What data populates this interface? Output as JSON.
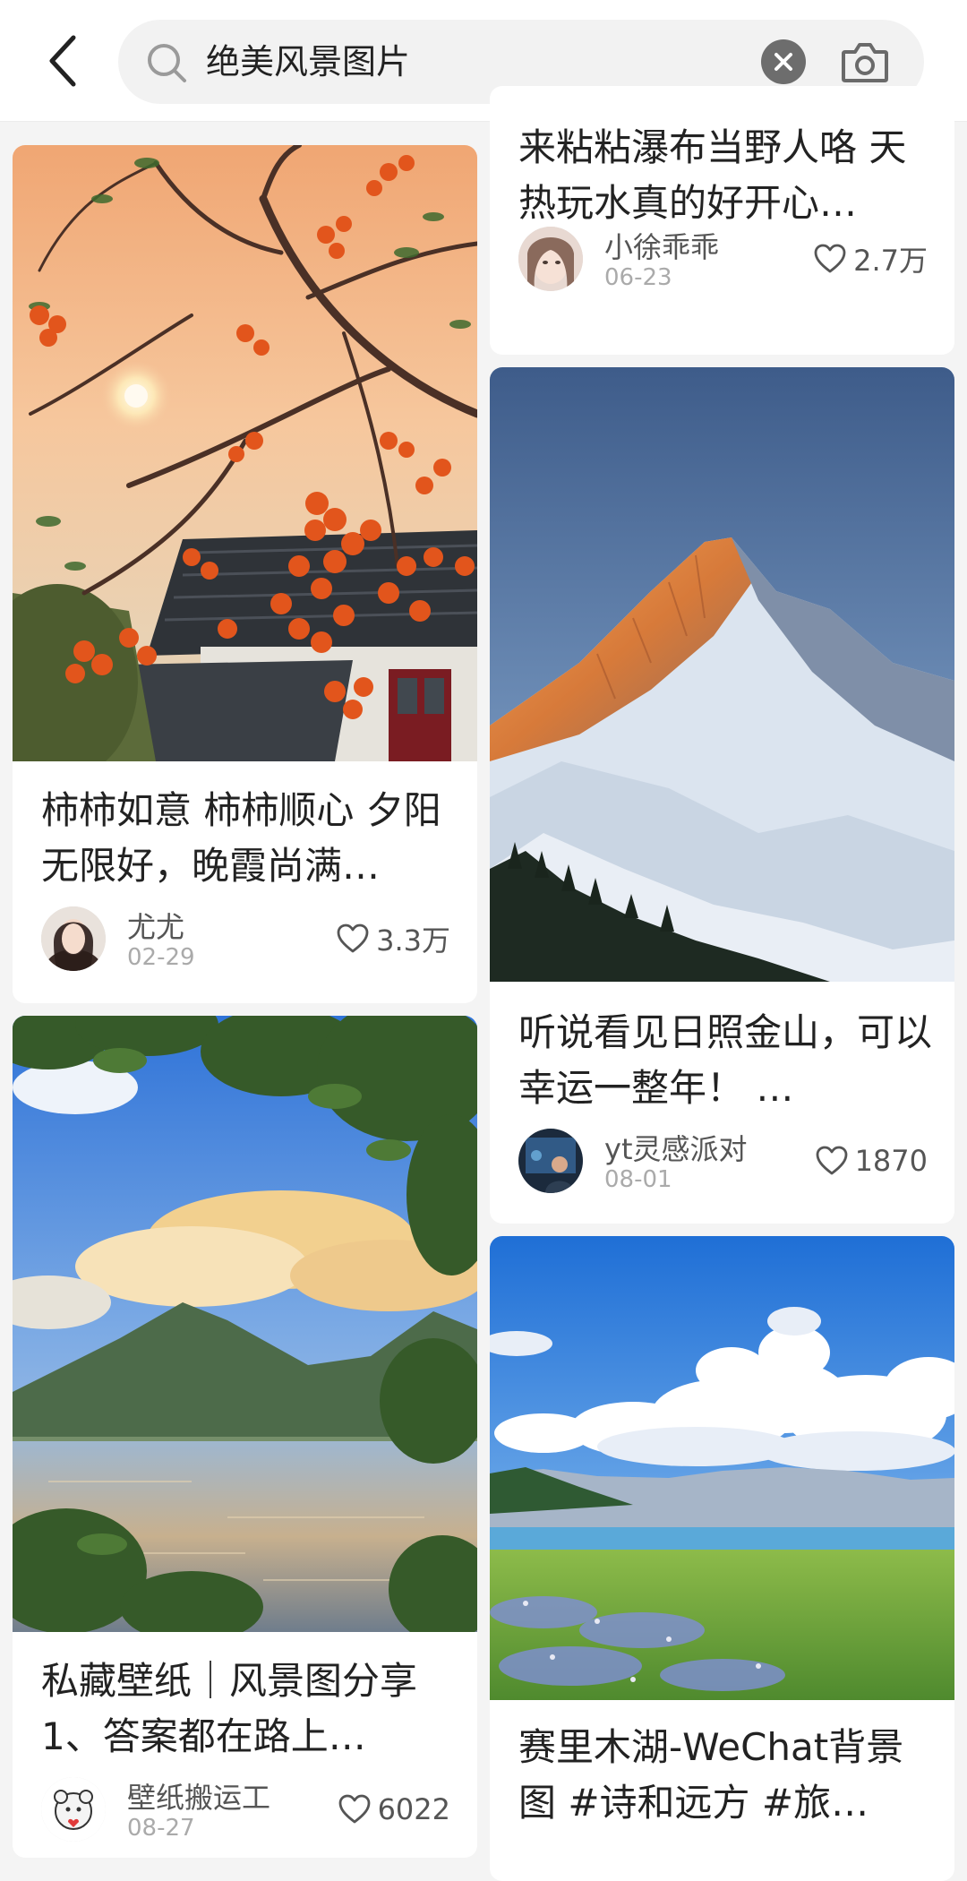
{
  "search": {
    "query": "绝美风景图片"
  },
  "cards": [
    {
      "title": "来粘粘瀑布当野人咯 天热玩水真的好开心…",
      "author": "小徐乖乖",
      "date": "06-23",
      "likes": "2.7万"
    },
    {
      "title": "柿柿如意 柿柿顺心 夕阳无限好，晚霞尚满…",
      "author": "尤尤",
      "date": "02-29",
      "likes": "3.3万"
    },
    {
      "title": "听说看见日照金山，可以幸运一整年！ …",
      "author": "yt灵感派对",
      "date": "08-01",
      "likes": "1870"
    },
    {
      "title": "私藏壁纸｜风景图分享 1、答案都在路上…",
      "author": "壁纸搬运工",
      "date": "08-27",
      "likes": "6022"
    },
    {
      "title": "赛里木湖-WeChat背景图 #诗和远方 #旅…",
      "author": "",
      "date": "",
      "likes": ""
    }
  ]
}
